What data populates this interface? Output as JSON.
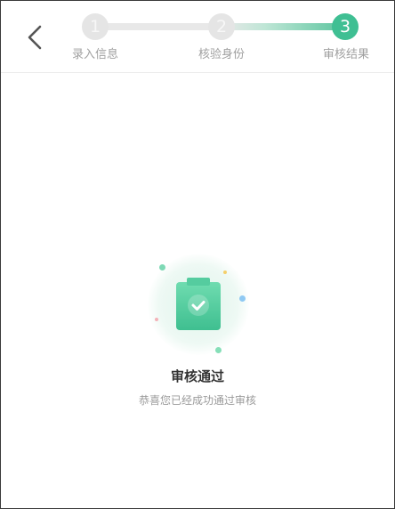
{
  "header": {
    "back_icon": "chevron-left-icon",
    "steps": [
      {
        "number": "1",
        "label": "录入信息",
        "state": "done"
      },
      {
        "number": "2",
        "label": "核验身份",
        "state": "done"
      },
      {
        "number": "3",
        "label": "审核结果",
        "state": "current"
      }
    ]
  },
  "result": {
    "icon": "clipboard-check-icon",
    "title": "审核通过",
    "description": "恭喜您已经成功通过审核"
  },
  "colors": {
    "accent": "#3fbf93",
    "inactive_step": "#e5e5e5",
    "label_gray": "#a0a0a0",
    "title_text": "#333333",
    "desc_text": "#9a9a9a"
  }
}
